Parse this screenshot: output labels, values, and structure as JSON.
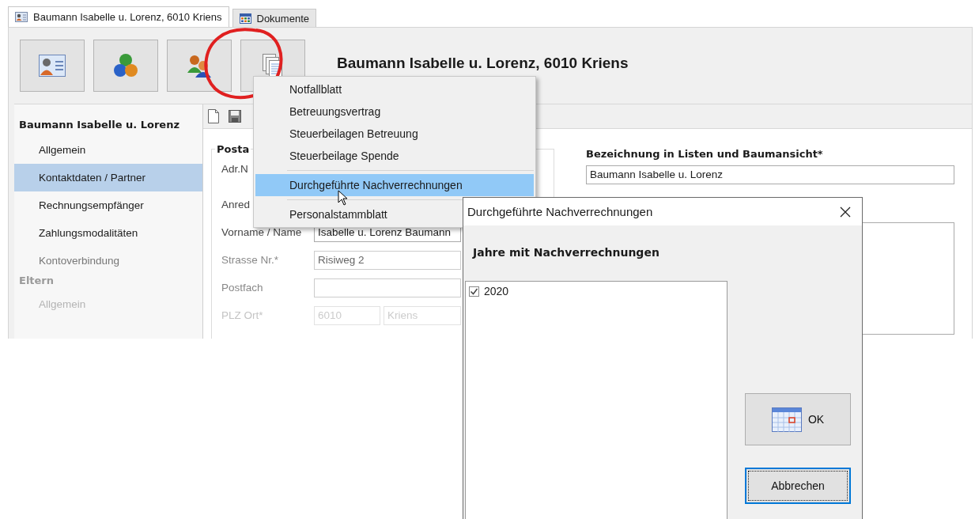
{
  "tabs": [
    {
      "label": "Baumann Isabelle u. Lorenz, 6010 Kriens",
      "selected": true
    },
    {
      "label": "Dokumente",
      "selected": false
    }
  ],
  "header_title": "Baumann Isabelle u. Lorenz, 6010 Kriens",
  "sidebar": {
    "sections": [
      {
        "title": "Baumann Isabelle u. Lorenz",
        "items": [
          {
            "label": "Allgemein",
            "selected": false
          },
          {
            "label": "Kontaktdaten / Partner",
            "selected": true
          },
          {
            "label": "Rechnungsempfänger",
            "selected": false
          },
          {
            "label": "Zahlungsmodalitäten",
            "selected": false
          },
          {
            "label": "Kontoverbindung",
            "selected": false
          }
        ]
      },
      {
        "title": "Eltern",
        "items": [
          {
            "label": "Allgemein",
            "selected": false
          }
        ]
      }
    ]
  },
  "address_group": {
    "title": "Posta",
    "rows": [
      {
        "label": "Adr.N",
        "kind": "label"
      },
      {
        "label": "Anred",
        "kind": "field"
      },
      {
        "label": "Vorname / Name",
        "kind": "field",
        "value": "Isabelle u. Lorenz Baumann"
      },
      {
        "label": "Strasse Nr.*",
        "kind": "field",
        "value": "Risiweg 2"
      },
      {
        "label": "Postfach",
        "kind": "field"
      },
      {
        "label": "PLZ Ort*",
        "kind": "pair",
        "values": [
          "6010",
          "Kriens"
        ]
      }
    ]
  },
  "designation": {
    "label": "Bezeichnung in Listen und Baumansicht*",
    "value": "Baumann Isabelle u. Lorenz"
  },
  "context_menu": {
    "items": [
      {
        "label": "Notfallblatt",
        "selected": false,
        "separator_before": false
      },
      {
        "label": "Betreuungsvertrag",
        "selected": false,
        "separator_before": false
      },
      {
        "label": "Steuerbeilagen Betreuung",
        "selected": false,
        "separator_before": false
      },
      {
        "label": "Steuerbeilage Spende",
        "selected": false,
        "separator_before": false
      },
      {
        "label": "Durchgeführte Nachverrechnungen",
        "selected": true,
        "separator_before": true
      },
      {
        "label": "Personalstammblatt",
        "selected": false,
        "separator_before": true
      }
    ]
  },
  "dialog": {
    "title": "Durchgeführte Nachverrechnungen",
    "list_label": "Jahre mit Nachverrechnungen",
    "years": [
      {
        "label": "2020",
        "checked": true
      }
    ],
    "buttons": [
      {
        "label": "OK",
        "kind": "icon",
        "focused": false
      },
      {
        "label": "Abbrechen",
        "kind": "plain",
        "focused": true
      }
    ]
  }
}
